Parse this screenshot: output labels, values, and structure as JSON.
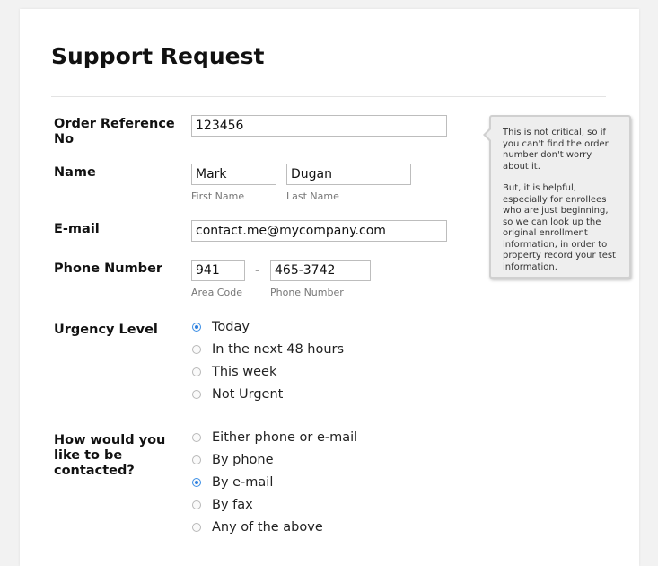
{
  "form": {
    "title": "Support Request",
    "order_ref": {
      "label": "Order Reference No",
      "value": "123456"
    },
    "name": {
      "label": "Name",
      "first_value": "Mark",
      "first_sublabel": "First Name",
      "last_value": "Dugan",
      "last_sublabel": "Last Name"
    },
    "email": {
      "label": "E-mail",
      "value": "contact.me@mycompany.com"
    },
    "phone": {
      "label": "Phone Number",
      "area_value": "941",
      "area_sublabel": "Area Code",
      "separator": "-",
      "number_value": "465-3742",
      "number_sublabel": "Phone Number"
    },
    "urgency": {
      "label": "Urgency Level",
      "options": [
        {
          "label": "Today",
          "checked": true
        },
        {
          "label": "In the next 48 hours",
          "checked": false
        },
        {
          "label": "This week",
          "checked": false
        },
        {
          "label": "Not Urgent",
          "checked": false
        }
      ]
    },
    "contact": {
      "label": "How would you like to be contacted?",
      "options": [
        {
          "label": "Either phone or e-mail",
          "checked": false
        },
        {
          "label": "By phone",
          "checked": false
        },
        {
          "label": "By e-mail",
          "checked": true
        },
        {
          "label": "By fax",
          "checked": false
        },
        {
          "label": "Any of the above",
          "checked": false
        }
      ]
    }
  },
  "tooltip": {
    "paragraph1": "This is not critical, so if you can't find the order number don't worry about it.",
    "paragraph2": "But, it is helpful, especially for enrollees who are just beginning, so we can look up the original enrollment information, in order to property record your test information."
  },
  "colors": {
    "accent": "#2d7fe0",
    "background": "#f2f2f2",
    "card": "#ffffff"
  }
}
